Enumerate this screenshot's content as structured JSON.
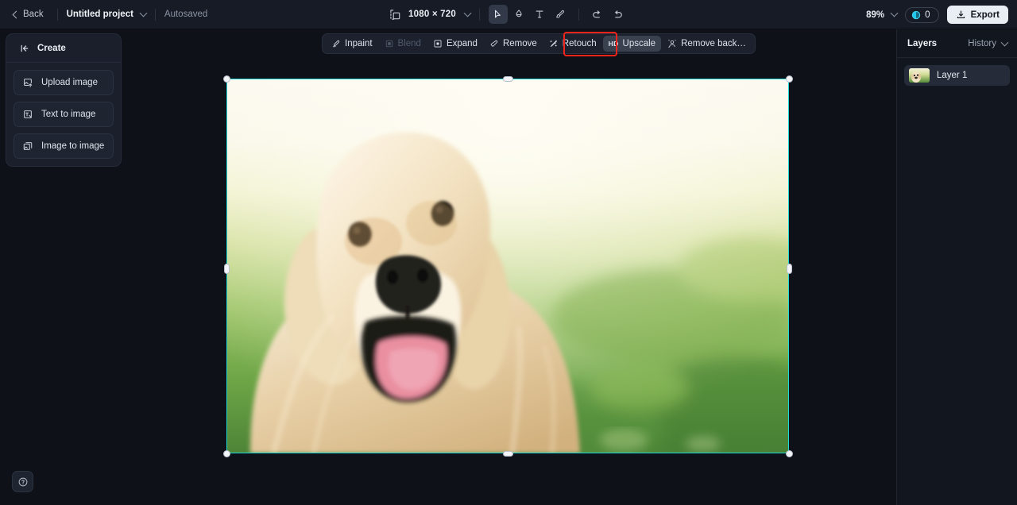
{
  "topbar": {
    "back_label": "Back",
    "project_name": "Untitled project",
    "autosave_label": "Autosaved",
    "canvas_size": "1080 × 720",
    "resize_icon": "resize-icon",
    "tools": [
      {
        "name": "select-tool",
        "icon": "cursor-arrow-icon",
        "active": true
      },
      {
        "name": "eraser-tool",
        "icon": "eraser-icon",
        "active": false
      },
      {
        "name": "text-tool",
        "icon": "text-t-icon",
        "active": false
      },
      {
        "name": "brush-tool",
        "icon": "brush-icon",
        "active": false
      }
    ],
    "undo_icon": "undo-icon",
    "redo_icon": "redo-icon",
    "zoom_level": "89%",
    "credits_count": "0",
    "export_label": "Export"
  },
  "sidebar": {
    "title": "Create",
    "collapse_icon": "collapse-left-icon",
    "items": [
      {
        "label": "Upload image",
        "icon": "upload-image-icon"
      },
      {
        "label": "Text to image",
        "icon": "text-to-image-icon"
      },
      {
        "label": "Image to image",
        "icon": "image-to-image-icon"
      }
    ],
    "help_icon": "help-question-icon"
  },
  "floating_toolbar": {
    "items": [
      {
        "label": "Inpaint",
        "icon": "inpaint-icon",
        "state": "normal"
      },
      {
        "label": "Blend",
        "icon": "blend-icon",
        "state": "disabled"
      },
      {
        "label": "Expand",
        "icon": "expand-icon",
        "state": "normal"
      },
      {
        "label": "Remove",
        "icon": "remove-eraser-icon",
        "state": "normal"
      },
      {
        "label": "Retouch",
        "icon": "retouch-wand-icon",
        "state": "normal"
      },
      {
        "label": "Upscale",
        "icon": "hd-badge",
        "state": "active",
        "badge": "HD"
      },
      {
        "label": "Remove back…",
        "icon": "remove-background-icon",
        "state": "normal"
      }
    ],
    "highlight_color": "#f2231b",
    "highlighted_item": "Upscale"
  },
  "canvas": {
    "selection_color": "#1fd8d8",
    "rotate_handle_icon": "rotate-icon",
    "image_alt": "golden retriever dog in grass"
  },
  "right_panel": {
    "tab_layers": "Layers",
    "tab_history": "History",
    "history_chevron_icon": "chevron-down-icon",
    "layers": [
      {
        "name": "Layer 1",
        "thumb": "dog-thumbnail"
      }
    ]
  }
}
